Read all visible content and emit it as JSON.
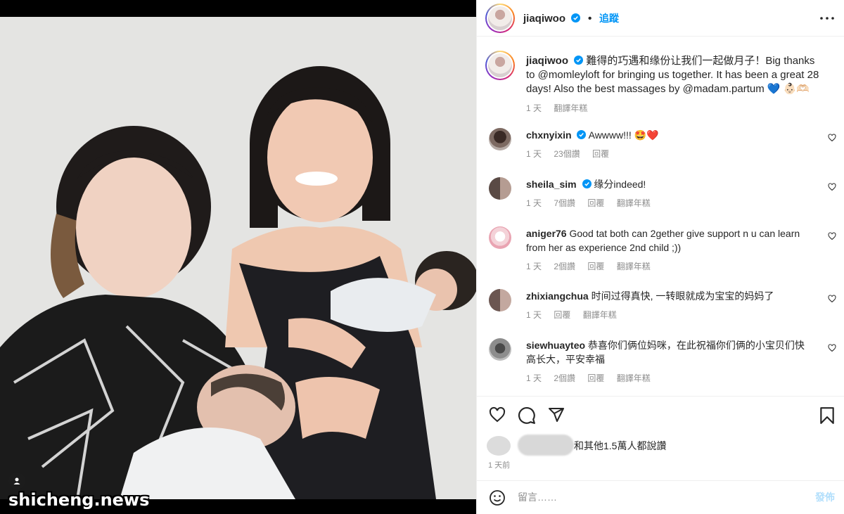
{
  "post": {
    "username": "jiaqiwoo",
    "follow_label": "追蹤",
    "caption": "難得的巧遇和缘份让我们一起做月子！Big thanks to @momleyloft for bringing us together. It has been a great 28 days! Also the best massages by @madam.partum 💙 👶🏻🫶🏻",
    "caption_time": "1 天",
    "caption_translate": "翻譯年糕"
  },
  "comments": [
    {
      "username": "chxnyixin",
      "verified": true,
      "text": "Awwww!!! 🤩❤️",
      "time": "1 天",
      "likes": "23個讚",
      "reply": "回覆",
      "translate": ""
    },
    {
      "username": "sheila_sim",
      "verified": true,
      "text": "缘分indeed!",
      "time": "1 天",
      "likes": "7個讚",
      "reply": "回覆",
      "translate": "翻譯年糕"
    },
    {
      "username": "aniger76",
      "verified": false,
      "text": "Good tat both can 2gether give support n u can learn from her as experience 2nd child ;))",
      "time": "1 天",
      "likes": "2個讚",
      "reply": "回覆",
      "translate": "翻譯年糕"
    },
    {
      "username": "zhixiangchua",
      "verified": false,
      "text": "时间过得真快, 一转眼就成为宝宝的妈妈了",
      "time": "1 天",
      "likes": "",
      "reply": "回覆",
      "translate": "翻譯年糕"
    },
    {
      "username": "siewhuayteo",
      "verified": false,
      "text": "恭喜你们俩位妈咪，在此祝福你们俩的小宝贝们快高长大，平安幸福",
      "time": "1 天",
      "likes": "2個讚",
      "reply": "回覆",
      "translate": "翻譯年糕"
    }
  ],
  "likes_text": "和其他1.5萬人都說讚",
  "post_time": "1 天前",
  "comment_input": {
    "placeholder": "留言……",
    "submit": "發佈"
  },
  "watermark": "shicheng.news",
  "colors": {
    "accent": "#0095f6",
    "secondary_text": "#8e8e8e",
    "verified": "#0095f6"
  }
}
